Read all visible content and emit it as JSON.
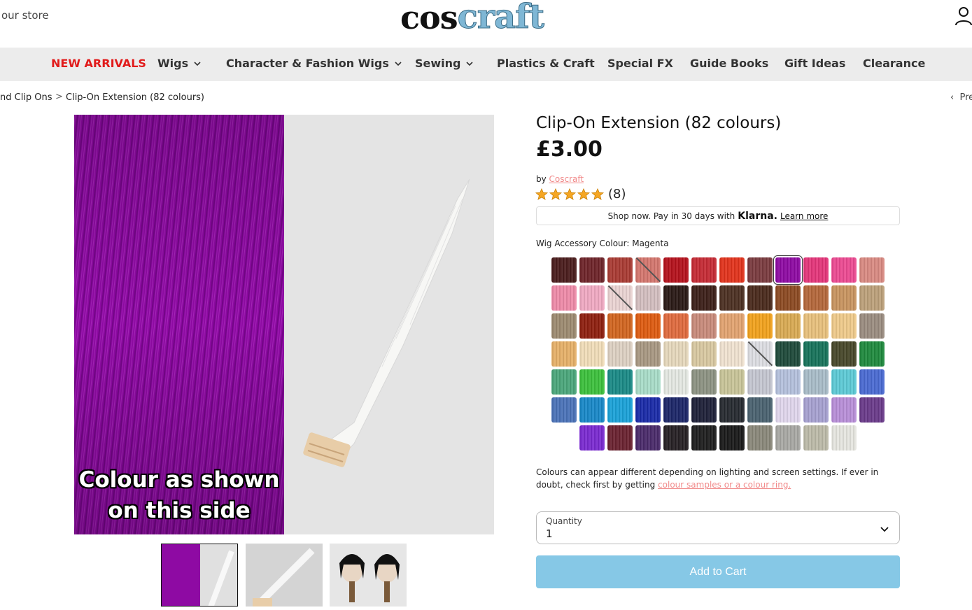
{
  "header": {
    "store_link": "our store",
    "logo_part1": "cos",
    "logo_part2": "craft"
  },
  "nav": [
    {
      "label": "NEW ARRIVALS",
      "dropdown": false,
      "highlight": true
    },
    {
      "label": "Wigs",
      "dropdown": true
    },
    {
      "label": "Character & Fashion Wigs",
      "dropdown": true
    },
    {
      "label": "Sewing",
      "dropdown": true
    },
    {
      "label": "Plastics & Craft",
      "dropdown": false
    },
    {
      "label": "Special FX",
      "dropdown": false
    },
    {
      "label": "Guide Books",
      "dropdown": false
    },
    {
      "label": "Gift Ideas",
      "dropdown": false
    },
    {
      "label": "Clearance",
      "dropdown": false
    }
  ],
  "breadcrumb": {
    "parent": "nd Clip Ons",
    "separator": ">",
    "current": "Clip-On Extension (82 colours)",
    "prev": "Pre"
  },
  "gallery": {
    "overlay_line1": "Colour as shown",
    "overlay_line2": "on this side",
    "colors": {
      "magenta": "#8e0aa3",
      "white_bg": "#e4e4e4"
    }
  },
  "product": {
    "title": "Clip-On Extension (82 colours)",
    "price": "£3.00",
    "by_prefix": "by",
    "brand": "Coscraft",
    "rating_stars": 5,
    "rating_count": "(8)",
    "klarna_text": "Shop now. Pay in 30 days with",
    "klarna_brand": "Klarna.",
    "klarna_link": "Learn more",
    "colour_label": "Wig Accessory Colour: Magenta",
    "note_text": "Colours can appear different depending on lighting and screen settings. If ever in doubt, check first by getting",
    "note_link": "colour samples or a colour ring.",
    "quantity_label": "Quantity",
    "quantity_value": "1",
    "add_to_cart": "Add to Cart",
    "accent": "#86c8e6",
    "star_color": "#f5a623"
  },
  "swatch_rows": [
    [
      {
        "color": "#4a1c1c"
      },
      {
        "color": "#6e2429"
      },
      {
        "color": "#a93b33"
      },
      {
        "color": "#d4766e",
        "sold_out": true
      },
      {
        "color": "#b5111c"
      },
      {
        "color": "#c52a34"
      },
      {
        "color": "#e2331c"
      },
      {
        "color": "#7a3b3f"
      },
      {
        "color": "#8e0aa3",
        "selected": true
      },
      {
        "color": "#e4357a"
      },
      {
        "color": "#ec4a92"
      },
      {
        "color": "#d98a82"
      }
    ],
    [
      {
        "color": "#ee8aa8"
      },
      {
        "color": "#f0a9c2"
      },
      {
        "color": "#ead3d2",
        "sold_out": true
      },
      {
        "color": "#d3bebf"
      },
      {
        "color": "#2a1a16"
      },
      {
        "color": "#3c1f18"
      },
      {
        "color": "#4c3022"
      },
      {
        "color": "#4a2a1c"
      },
      {
        "color": "#8c4a22"
      },
      {
        "color": "#b4673a"
      },
      {
        "color": "#c8945f"
      },
      {
        "color": "#bca07a"
      }
    ],
    [
      {
        "color": "#9c8a70"
      },
      {
        "color": "#8e1f0f"
      },
      {
        "color": "#d1651f"
      },
      {
        "color": "#de5b10"
      },
      {
        "color": "#e06a3e"
      },
      {
        "color": "#c88a7a"
      },
      {
        "color": "#e2a370"
      },
      {
        "color": "#f2a21c"
      },
      {
        "color": "#d9aa53"
      },
      {
        "color": "#e8c07c"
      },
      {
        "color": "#efca8a"
      },
      {
        "color": "#9a8c80"
      }
    ],
    [
      {
        "color": "#e6b068"
      },
      {
        "color": "#f1ddb9"
      },
      {
        "color": "#ddd0c2"
      },
      {
        "color": "#a89882"
      },
      {
        "color": "#e6d8bc"
      },
      {
        "color": "#d8c8a0"
      },
      {
        "color": "#f0e2d0"
      },
      {
        "color": "#dcdde2",
        "sold_out": true
      },
      {
        "color": "#1e4a3a"
      },
      {
        "color": "#17735a"
      },
      {
        "color": "#47472a"
      },
      {
        "color": "#1f8a3e"
      }
    ],
    [
      {
        "color": "#4aa67a"
      },
      {
        "color": "#3cc03c"
      },
      {
        "color": "#1a8a86"
      },
      {
        "color": "#a8dcc8"
      },
      {
        "color": "#e4e8e2"
      },
      {
        "color": "#8c9282"
      },
      {
        "color": "#c8c498"
      },
      {
        "color": "#c4c6d0"
      },
      {
        "color": "#b4c0dc"
      },
      {
        "color": "#a8bcc8"
      },
      {
        "color": "#5ccad6"
      },
      {
        "color": "#4a6ad2"
      }
    ],
    [
      {
        "color": "#4a72b8"
      },
      {
        "color": "#1888c8"
      },
      {
        "color": "#1aa2d8"
      },
      {
        "color": "#1a2aa8"
      },
      {
        "color": "#1c2668"
      },
      {
        "color": "#1e2038"
      },
      {
        "color": "#262a30"
      },
      {
        "color": "#4a6270"
      },
      {
        "color": "#e0d6ec"
      },
      {
        "color": "#a6a0d0"
      },
      {
        "color": "#b88ed8"
      },
      {
        "color": "#6a3a8a"
      }
    ],
    [
      {
        "color": "#7a2ad0"
      },
      {
        "color": "#6a2230"
      },
      {
        "color": "#4a2a6a"
      },
      {
        "color": "#262024"
      },
      {
        "color": "#1e1e1e"
      },
      {
        "color": "#1a1a1a"
      },
      {
        "color": "#8a887a"
      },
      {
        "color": "#a8a8a4"
      },
      {
        "color": "#bcbaa8"
      },
      {
        "color": "#e6e6e0"
      }
    ]
  ]
}
